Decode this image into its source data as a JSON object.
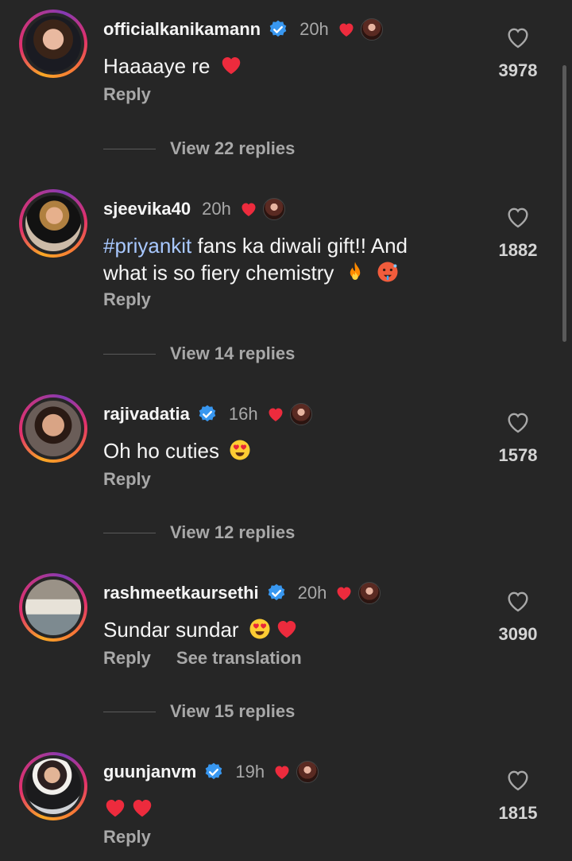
{
  "comments": [
    {
      "username": "officialkanikamann",
      "verified": true,
      "time": "20h",
      "text": "Haaaaye re",
      "text_emojis": [
        "red-heart"
      ],
      "likes": "3978",
      "reply_label": "Reply",
      "view_replies": "View 22 replies"
    },
    {
      "username": "sjeevika40",
      "verified": false,
      "time": "20h",
      "hashtag": "#priyankit",
      "text": " fans ka diwali gift!! And what is so fiery chemistry",
      "text_emojis": [
        "fire",
        "hot-face"
      ],
      "likes": "1882",
      "reply_label": "Reply",
      "view_replies": "View 14 replies"
    },
    {
      "username": "rajivadatia",
      "verified": true,
      "time": "16h",
      "text": "Oh ho cuties",
      "text_emojis": [
        "heart-eyes"
      ],
      "likes": "1578",
      "reply_label": "Reply",
      "view_replies": "View 12 replies"
    },
    {
      "username": "rashmeetkaursethi",
      "verified": true,
      "time": "20h",
      "text": "Sundar sundar",
      "text_emojis": [
        "heart-eyes",
        "red-heart"
      ],
      "likes": "3090",
      "reply_label": "Reply",
      "translation_label": "See translation",
      "view_replies": "View 15 replies"
    },
    {
      "username": "guunjanvm",
      "verified": true,
      "time": "19h",
      "text": "",
      "text_emojis": [
        "red-heart",
        "red-heart"
      ],
      "likes": "1815",
      "reply_label": "Reply"
    }
  ],
  "colors": {
    "background": "#262626",
    "verified_blue": "#3897f0",
    "heart_red": "#ed2b3d",
    "hashtag": "#a8c8ff"
  }
}
